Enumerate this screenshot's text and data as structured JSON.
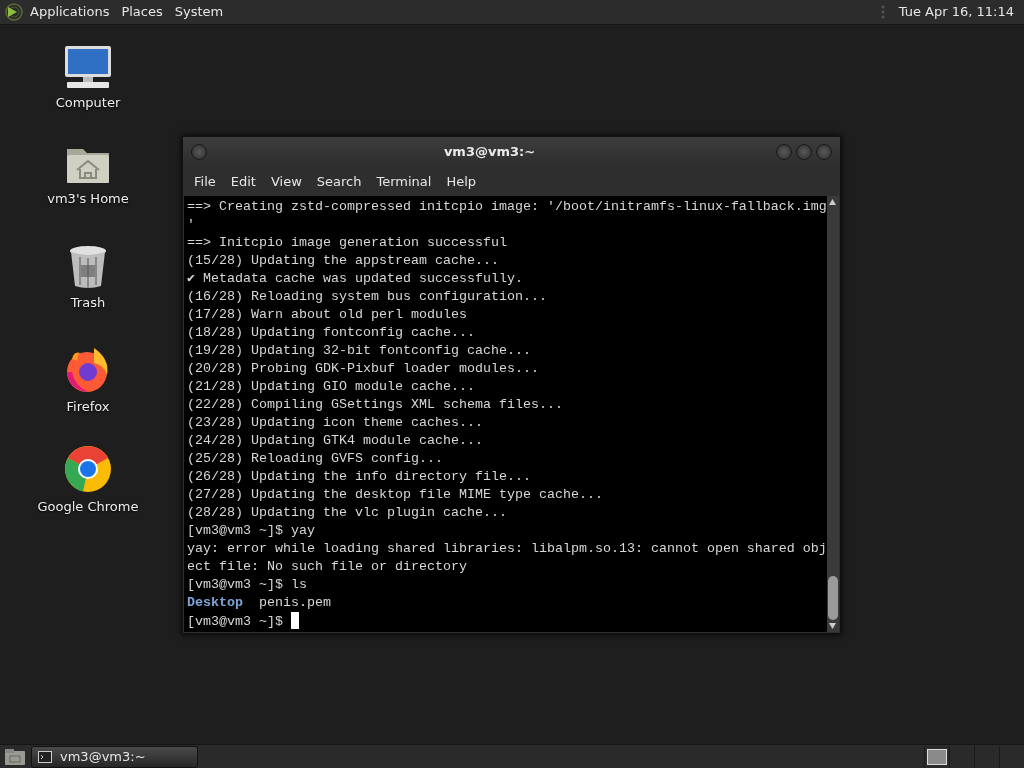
{
  "top_panel": {
    "menus": [
      "Applications",
      "Places",
      "System"
    ],
    "clock": "Tue Apr 16, 11:14"
  },
  "desktop_icons": [
    {
      "label": "Computer",
      "kind": "computer"
    },
    {
      "label": "vm3's Home",
      "kind": "home"
    },
    {
      "label": "Trash",
      "kind": "trash"
    },
    {
      "label": "Firefox",
      "kind": "firefox"
    },
    {
      "label": "Google Chrome",
      "kind": "chrome"
    }
  ],
  "window": {
    "title": "vm3@vm3:~",
    "menu": [
      "File",
      "Edit",
      "View",
      "Search",
      "Terminal",
      "Help"
    ],
    "lines": [
      {
        "kind": "text",
        "text": "==> Creating zstd-compressed initcpio image: '/boot/initramfs-linux-fallback.img"
      },
      {
        "kind": "text",
        "text": "'"
      },
      {
        "kind": "text",
        "text": "==> Initcpio image generation successful"
      },
      {
        "kind": "text",
        "text": "(15/28) Updating the appstream cache..."
      },
      {
        "kind": "text",
        "text": "✔ Metadata cache was updated successfully."
      },
      {
        "kind": "text",
        "text": "(16/28) Reloading system bus configuration..."
      },
      {
        "kind": "text",
        "text": "(17/28) Warn about old perl modules"
      },
      {
        "kind": "text",
        "text": "(18/28) Updating fontconfig cache..."
      },
      {
        "kind": "text",
        "text": "(19/28) Updating 32-bit fontconfig cache..."
      },
      {
        "kind": "text",
        "text": "(20/28) Probing GDK-Pixbuf loader modules..."
      },
      {
        "kind": "text",
        "text": "(21/28) Updating GIO module cache..."
      },
      {
        "kind": "text",
        "text": "(22/28) Compiling GSettings XML schema files..."
      },
      {
        "kind": "text",
        "text": "(23/28) Updating icon theme caches..."
      },
      {
        "kind": "text",
        "text": "(24/28) Updating GTK4 module cache..."
      },
      {
        "kind": "text",
        "text": "(25/28) Reloading GVFS config..."
      },
      {
        "kind": "text",
        "text": "(26/28) Updating the info directory file..."
      },
      {
        "kind": "text",
        "text": "(27/28) Updating the desktop file MIME type cache..."
      },
      {
        "kind": "text",
        "text": "(28/28) Updating the vlc plugin cache..."
      },
      {
        "kind": "text",
        "text": "[vm3@vm3 ~]$ yay"
      },
      {
        "kind": "text",
        "text": "yay: error while loading shared libraries: libalpm.so.13: cannot open shared obj"
      },
      {
        "kind": "text",
        "text": "ect file: No such file or directory"
      },
      {
        "kind": "text",
        "text": "[vm3@vm3 ~]$ ls"
      },
      {
        "kind": "listing",
        "parts": [
          {
            "text": "Desktop",
            "kind": "dir"
          },
          {
            "text": "penis.pem",
            "kind": "file"
          }
        ]
      },
      {
        "kind": "prompt",
        "text": "[vm3@vm3 ~]$",
        "cursor": true
      }
    ]
  },
  "taskbar": {
    "tasks": [
      {
        "label": "vm3@vm3:~",
        "selected": true
      }
    ],
    "workspaces": [
      {
        "selected": true
      },
      {
        "selected": false
      },
      {
        "selected": false
      },
      {
        "selected": false
      }
    ]
  }
}
